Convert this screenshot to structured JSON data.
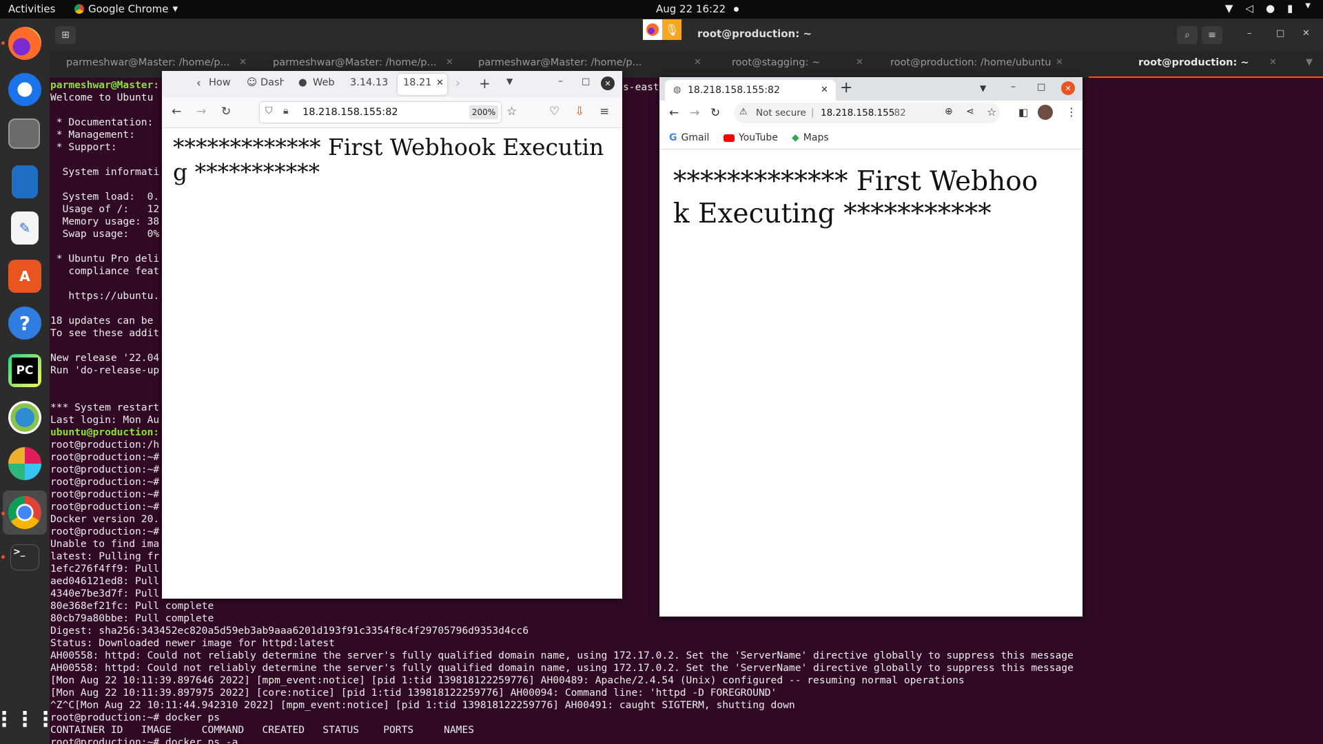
{
  "topbar": {
    "activities": "Activities",
    "app_name": "Google Chrome",
    "clock": "Aug 22  16:22"
  },
  "dock": {
    "apps": [
      "firefox-icon",
      "thunderbird-icon",
      "files-icon",
      "writer-icon",
      "text-editor-icon",
      "app-center-icon",
      "help-icon",
      "pycharm-icon",
      "remmina-icon",
      "slack-icon",
      "chrome-icon",
      "terminal-icon"
    ],
    "pycharm_label": "PC"
  },
  "terminal": {
    "title": "root@production: ~",
    "tabs": [
      {
        "label": "parmeshwar@Master: /home/p..."
      },
      {
        "label": "parmeshwar@Master: /home/p..."
      },
      {
        "label": "parmeshwar@Master: /home/p..."
      },
      {
        "label": "root@stagging: ~"
      },
      {
        "label": "root@production: /home/ubuntu"
      },
      {
        "label": "root@production: ~"
      }
    ],
    "lines_top": [
      "parmeshwar@Master:",
      "Welcome to Ubuntu",
      "",
      " * Documentation:",
      " * Management:",
      " * Support:",
      "",
      "  System informati",
      "",
      "  System load:  0.",
      "  Usage of /:   12",
      "  Memory usage: 38",
      "  Swap usage:   0%",
      "",
      " * Ubuntu Pro deli",
      "   compliance feat",
      "",
      "   https://ubuntu.",
      "",
      "18 updates can be",
      "To see these addit",
      "",
      "New release '22.04",
      "Run 'do-release-up",
      "",
      "",
      "*** System restart",
      "Last login: Mon Au",
      "ubuntu@production:",
      "root@production:/h",
      "root@production:~#",
      "root@production:~#",
      "root@production:~#",
      "root@production:~#",
      "root@production:~#",
      "Docker version 20.",
      "root@production:~#",
      "Unable to find ima",
      "latest: Pulling fr",
      "1efc276f4ff9: Pull",
      "aed046121ed8: Pull",
      "4340e7be3d7f: Pull"
    ],
    "right_fragment": "s-east",
    "lines_bottom": [
      "80e368ef21fc: Pull complete",
      "80cb79a80bbe: Pull complete",
      "Digest: sha256:343452ec820a5d59eb3ab9aaa6201d193f91c3354f8c4f29705796d9353d4cc6",
      "Status: Downloaded newer image for httpd:latest",
      "AH00558: httpd: Could not reliably determine the server's fully qualified domain name, using 172.17.0.2. Set the 'ServerName' directive globally to suppress this message",
      "AH00558: httpd: Could not reliably determine the server's fully qualified domain name, using 172.17.0.2. Set the 'ServerName' directive globally to suppress this message",
      "[Mon Aug 22 10:11:39.897646 2022] [mpm_event:notice] [pid 1:tid 139818122259776] AH00489: Apache/2.4.54 (Unix) configured -- resuming normal operations",
      "[Mon Aug 22 10:11:39.897975 2022] [core:notice] [pid 1:tid 139818122259776] AH00094: Command line: 'httpd -D FOREGROUND'",
      "^Z^C[Mon Aug 22 10:11:44.942310 2022] [mpm_event:notice] [pid 1:tid 139818122259776] AH00491: caught SIGTERM, shutting down",
      "root@production:~# docker ps",
      "CONTAINER ID   IMAGE     COMMAND   CREATED   STATUS    PORTS     NAMES",
      "root@production:~# docker ps -a"
    ]
  },
  "firefox": {
    "tabs": [
      "How",
      "Dash",
      "Web",
      "3.14.13",
      "18.21"
    ],
    "url": "18.218.158.155:82",
    "zoom": "200%",
    "heading": "************* First Webhook Executing ***********"
  },
  "chrome": {
    "tab_title": "18.218.158.155:82",
    "not_secure": "Not secure",
    "url_host": "18.218.158.155",
    "url_port": ":82",
    "bookmarks": [
      "Gmail",
      "YouTube",
      "Maps"
    ],
    "heading": "************* First Webhook Executing ***********"
  },
  "colors": {
    "terminal_bg": "#300a24",
    "prompt_green": "#8ae234",
    "ubuntu_orange": "#e95420"
  }
}
